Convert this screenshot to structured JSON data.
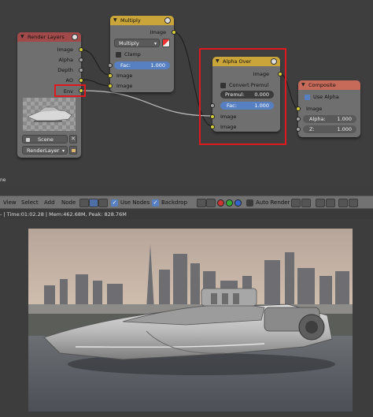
{
  "node_editor": {
    "editor_mode_label": "ne",
    "render_layers": {
      "title": "Render Layers",
      "outputs": [
        "Image",
        "Alpha",
        "Depth",
        "AO",
        "Env"
      ],
      "scene": "Scene",
      "layer": "RenderLayer"
    },
    "multiply": {
      "title": "Multiply",
      "output": "Image",
      "blend_mode": "Multiply",
      "clamp_label": "Clamp",
      "fac_label": "Fac:",
      "fac_value": "1.000",
      "inputs": [
        "Image",
        "Image"
      ]
    },
    "alpha_over": {
      "title": "Alpha Over",
      "output": "Image",
      "convert_premul_label": "Convert Premul",
      "premul_label": "Premul:",
      "premul_value": "0.000",
      "fac_label": "Fac:",
      "fac_value": "1.000",
      "inputs": [
        "Image",
        "Image"
      ]
    },
    "composite": {
      "title": "Composite",
      "use_alpha_label": "Use Alpha",
      "image_label": "Image",
      "alpha_label": "Alpha:",
      "alpha_value": "1.000",
      "z_label": "Z:",
      "z_value": "1.000"
    }
  },
  "toolbar": {
    "menu_view": "View",
    "menu_select": "Select",
    "menu_add": "Add",
    "menu_node": "Node",
    "use_nodes_label": "Use Nodes",
    "backdrop_label": "Backdrop",
    "auto_render_label": "Auto Render"
  },
  "status_bar": {
    "text": "- | Time:01:02.28 | Mem:462.68M, Peak: 828.76M"
  },
  "colors": {
    "highlight": "#e0191e",
    "socket_yellow": "#d7cd3a",
    "socket_grey": "#a1a1a1",
    "field_blue": "#5680c2"
  }
}
